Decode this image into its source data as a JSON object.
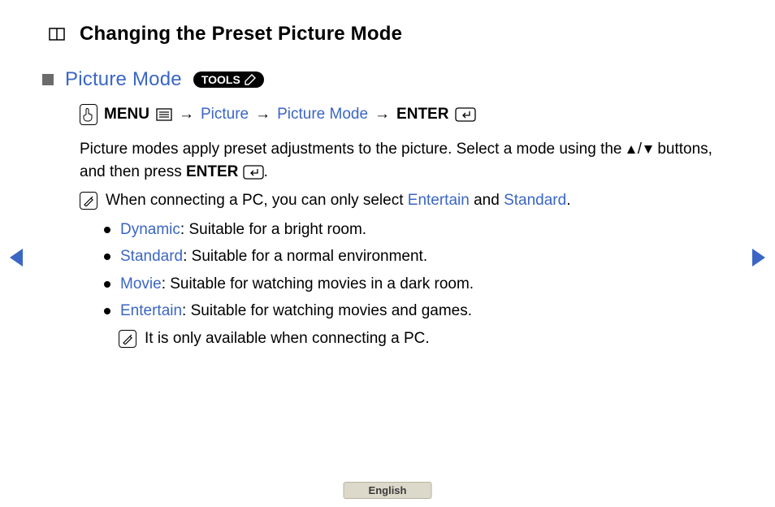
{
  "title": "Changing the Preset Picture Mode",
  "section": {
    "title": "Picture Mode",
    "tools_label": "TOOLS"
  },
  "nav": {
    "menu": "MENU",
    "arrow": "→",
    "step1": "Picture",
    "step2": "Picture Mode",
    "enter": "ENTER"
  },
  "paragraph": {
    "line1": "Picture modes apply preset adjustments to the picture. Select a mode using the ",
    "line2_prefix": " buttons, and then press ",
    "line2_enter": "ENTER",
    "line2_suffix": "."
  },
  "note1": {
    "prefix": "When connecting a PC, you can only select ",
    "entertain": "Entertain",
    "and": " and ",
    "standard": "Standard",
    "suffix": "."
  },
  "modes": [
    {
      "name": "Dynamic",
      "desc": ": Suitable for a bright room."
    },
    {
      "name": "Standard",
      "desc": ": Suitable for a normal environment."
    },
    {
      "name": "Movie",
      "desc": ": Suitable for watching movies in a dark room."
    },
    {
      "name": "Entertain",
      "desc": ": Suitable for watching movies and games."
    }
  ],
  "note2": "It is only available when connecting a PC.",
  "footer": {
    "language": "English"
  }
}
